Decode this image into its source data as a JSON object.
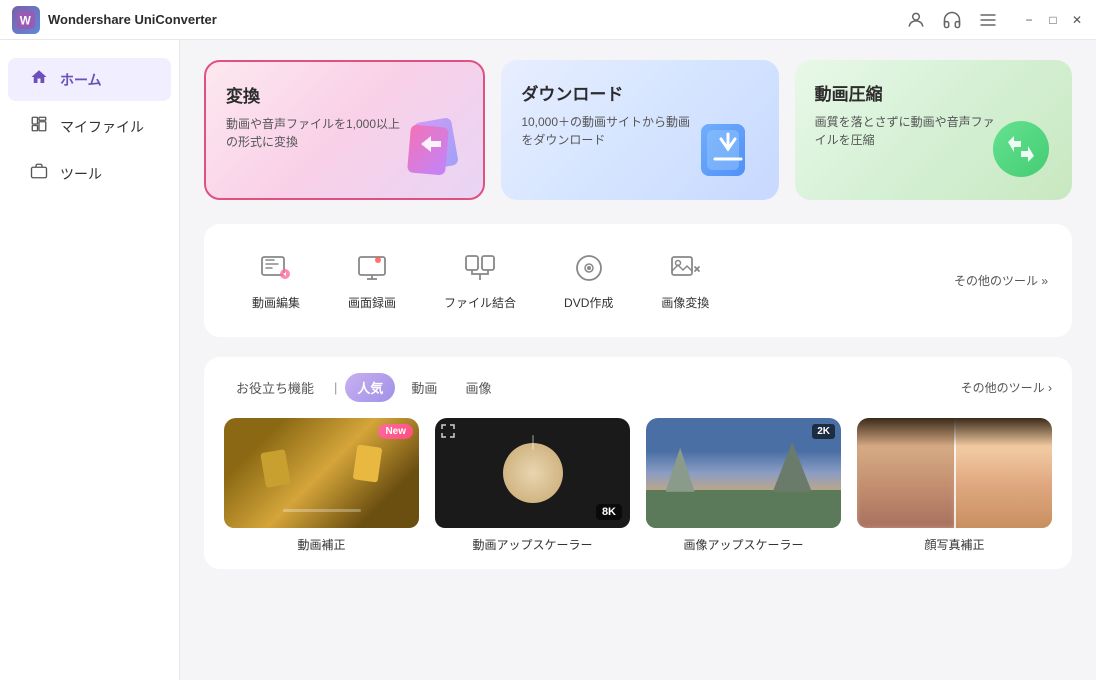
{
  "app": {
    "name": "UniConverter",
    "brand": "Wondershare"
  },
  "titlebar": {
    "user_icon": "👤",
    "headset_icon": "🎧",
    "menu_icon": "☰",
    "minimize_label": "−",
    "maximize_label": "□",
    "close_label": "✕"
  },
  "sidebar": {
    "items": [
      {
        "id": "home",
        "label": "ホーム",
        "icon": "🏠",
        "active": true
      },
      {
        "id": "myfiles",
        "label": "マイファイル",
        "icon": "📁",
        "active": false
      },
      {
        "id": "tools",
        "label": "ツール",
        "icon": "🧰",
        "active": false
      }
    ]
  },
  "feature_cards": [
    {
      "id": "convert",
      "title": "変換",
      "desc": "動画や音声ファイルを1,000以上の形式に変換",
      "highlighted": true
    },
    {
      "id": "download",
      "title": "ダウンロード",
      "desc": "10,000＋の動画サイトから動画をダウンロード"
    },
    {
      "id": "compress",
      "title": "動画圧縮",
      "desc": "画質を落とさずに動画や音声ファイルを圧縮"
    }
  ],
  "tools": {
    "items": [
      {
        "id": "video-edit",
        "label": "動画編集"
      },
      {
        "id": "screen-record",
        "label": "画面録画"
      },
      {
        "id": "file-merge",
        "label": "ファイル結合"
      },
      {
        "id": "dvd-create",
        "label": "DVD作成"
      },
      {
        "id": "image-convert",
        "label": "画像変換"
      }
    ],
    "more_label": "その他のツール »"
  },
  "popular_section": {
    "tabs": [
      {
        "id": "useful",
        "label": "お役立ち機能",
        "active": false
      },
      {
        "id": "popular",
        "label": "人気",
        "active": true
      },
      {
        "id": "video",
        "label": "動画",
        "active": false
      },
      {
        "id": "image",
        "label": "画像",
        "active": false
      }
    ],
    "separator": "|",
    "more_label": "その他のツール ›",
    "cards": [
      {
        "id": "video-enhance",
        "label": "動画補正",
        "badge": "New",
        "has_new": true,
        "has_8k": false,
        "has_2k": false
      },
      {
        "id": "video-upscaler",
        "label": "動画アップスケーラー",
        "badge": "8K",
        "has_new": false,
        "has_8k": true,
        "has_2k": false
      },
      {
        "id": "image-upscaler",
        "label": "画像アップスケーラー",
        "badge": "2K",
        "has_new": false,
        "has_8k": false,
        "has_2k": true
      },
      {
        "id": "face-restore",
        "label": "顔写真補正",
        "has_new": false,
        "has_8k": false,
        "has_2k": false
      }
    ]
  }
}
